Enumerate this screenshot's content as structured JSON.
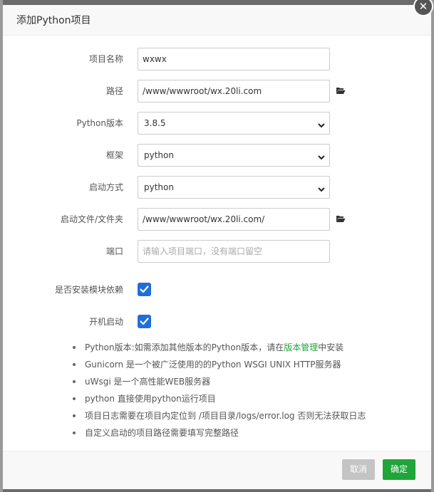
{
  "dialog": {
    "title": "添加Python项目",
    "close_symbol": "✕"
  },
  "form": {
    "project_name": {
      "label": "项目名称",
      "value": "wxwx"
    },
    "path": {
      "label": "路径",
      "value": "/www/wwwroot/wx.20li.com"
    },
    "python_version": {
      "label": "Python版本",
      "value": "3.8.5"
    },
    "framework": {
      "label": "框架",
      "value": "python"
    },
    "startup_method": {
      "label": "启动方式",
      "value": "python"
    },
    "startup_file": {
      "label": "启动文件/文件夹",
      "value": "/www/wwwroot/wx.20li.com/"
    },
    "port": {
      "label": "端口",
      "value": "",
      "placeholder": "请输入项目端口，没有端口留空"
    },
    "install_deps": {
      "label": "是否安装模块依赖",
      "checked": true
    },
    "autostart": {
      "label": "开机启动",
      "checked": true
    }
  },
  "notes": {
    "n1_before": "Python版本:如需添加其他版本的Python版本，请在",
    "n1_link": "版本管理",
    "n1_after": "中安装",
    "n2": "Gunicorn 是一个被广泛使用的的Python WSGI UNIX HTTP服务器",
    "n3": "uWsgi 是一个高性能WEB服务器",
    "n4": "python 直接使用python运行项目",
    "n5": "项目日志需要在项目内定位到 /项目目录/logs/error.log 否则无法获取日志",
    "n6": "自定义启动的项目路径需要填写完整路径"
  },
  "footer": {
    "cancel_label": "取消",
    "ok_label": "确定"
  },
  "colors": {
    "accent_green": "#20a53a",
    "checkbox_blue": "#1e6fd9",
    "disabled_gray": "#c4c4c4"
  }
}
